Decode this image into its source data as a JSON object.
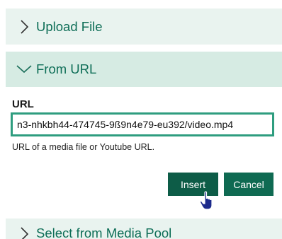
{
  "panels": {
    "upload": {
      "label": "Upload File",
      "icon": "chevron-right-icon"
    },
    "url": {
      "label": "From URL",
      "icon": "chevron-down-icon"
    },
    "pool": {
      "label": "Select from Media Pool",
      "icon": "chevron-right-icon"
    }
  },
  "url_form": {
    "label": "URL",
    "value": "n3-nhkbh44-474745-9ß9n4e79-eu392/video.mp4",
    "help": "URL of a media file or Youtube URL."
  },
  "buttons": {
    "insert": "Insert",
    "cancel": "Cancel"
  },
  "cursor": {
    "icon": "hand-pointer-icon"
  },
  "colors": {
    "accent": "#0e6e57",
    "header_bg": "#e9f3ef",
    "header_active_bg": "#d6ebe3",
    "button_bg": "#0d5c47",
    "input_border": "#2e9d7f"
  }
}
